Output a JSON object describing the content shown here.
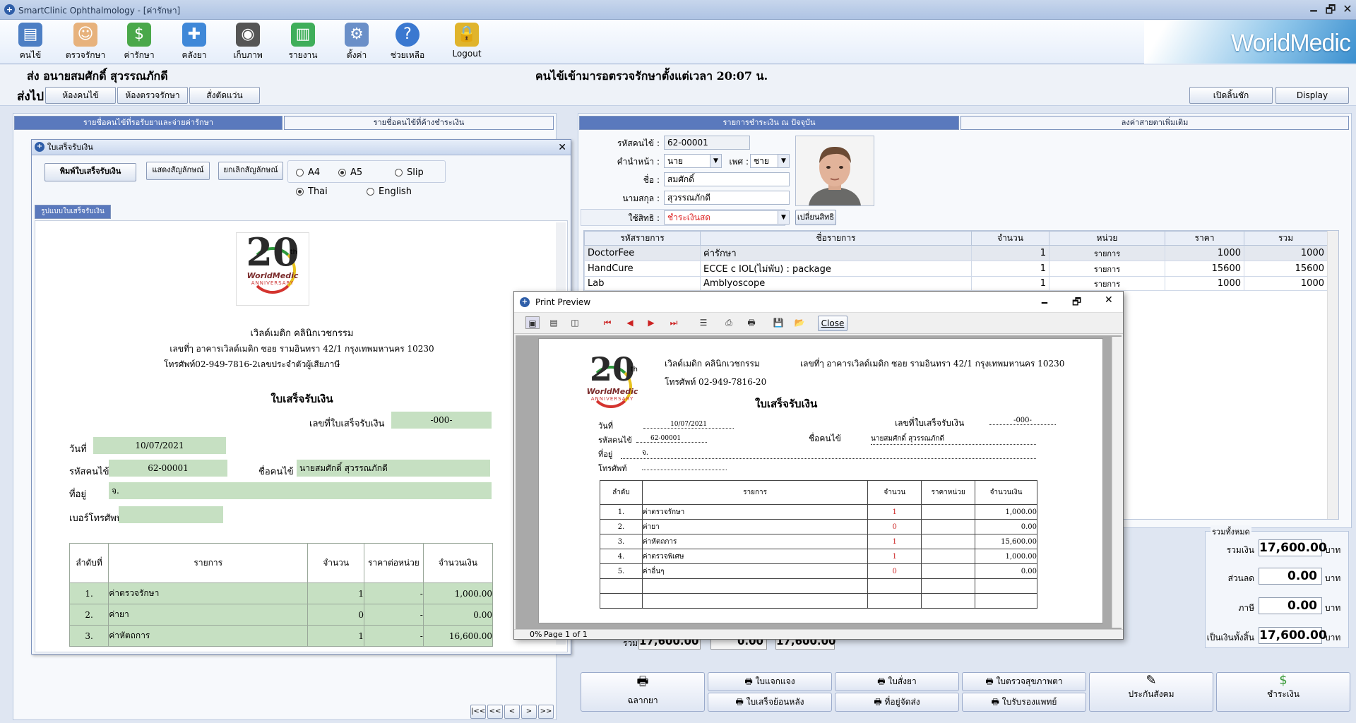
{
  "window": {
    "title": "SmartClinic Ophthalmology - [ค่ารักษา]",
    "minimize": "🗕",
    "restore": "🗗",
    "close": "✕"
  },
  "toolbar": {
    "items": [
      {
        "label": "คนไข้"
      },
      {
        "label": "ตรวจรักษา"
      },
      {
        "label": "ค่ารักษา"
      },
      {
        "label": "คลังยา"
      },
      {
        "label": "เก็บภาพ"
      },
      {
        "label": "รายงาน"
      },
      {
        "label": "ตั้งค่า"
      },
      {
        "label": "ช่วยเหลือ"
      },
      {
        "label": "Logout"
      }
    ],
    "brand": "WorldMedic"
  },
  "banner": {
    "patient": "ส่ง  อนายสมศักดิ์ สุวรรณภักดี",
    "status": "คนไข้เข้ามารอตรวจรักษาตั้งแต่เวลา 20:07 น."
  },
  "nav": {
    "send_to": "ส่งไป",
    "btn1": "ห้องคนไข้",
    "btn2": "ห้องตรวจรักษา",
    "btn3": "สั่งตัดแว่น",
    "open_drawer": "เปิดลิ้นชัก",
    "display": "Display"
  },
  "left_tabs": {
    "tab1": "รายชื่อคนไข้ที่รอรับยาและจ่ายค่ารักษา",
    "tab2": "รายชื่อคนไข้ที่ค้างชำระเงิน"
  },
  "right_tabs": {
    "tab1": "รายการชำระเงิน ณ ปัจจุบัน",
    "tab2": "ลงค่าสายตาเพิ่มเติม"
  },
  "patient": {
    "id_label": "รหัสคนไข้ :",
    "id": "62-00001",
    "prefix_label": "คำนำหน้า :",
    "prefix": "นาย",
    "sex_label": "เพศ :",
    "sex": "ชาย",
    "name_label": "ชื่อ :",
    "name": "สมศักดิ์",
    "surname_label": "นามสกุล :",
    "surname": "สุวรรณภักดี",
    "right_label": "ใช้สิทธิ :",
    "right": "ชำระเงินสด",
    "change_right": "เปลี่ยนสิทธิ",
    "ddarrow": "▼"
  },
  "items_grid": {
    "headers": [
      "รหัสรายการ",
      "ชื่อรายการ",
      "จำนวน",
      "หน่วย",
      "ราคา",
      "รวม"
    ],
    "rows": [
      [
        "DoctorFee",
        "ค่ารักษา",
        "1",
        "รายการ",
        "1000",
        "1000"
      ],
      [
        "HandCure",
        "ECCE c IOL(ไม่พับ) : package",
        "1",
        "รายการ",
        "15600",
        "15600"
      ],
      [
        "Lab",
        "Amblyoscope",
        "1",
        "รายการ",
        "1000",
        "1000"
      ]
    ]
  },
  "totals": {
    "group": "รวมทั้งหมด",
    "sum_label": "รวมเงิน",
    "sum": "17,600.00",
    "discount_label": "ส่วนลด",
    "discount": "0.00",
    "tax_label": "ภาษี",
    "tax": "0.00",
    "net_label": "เป็นเงินทั้งสิ้น",
    "net": "17,600.00",
    "unit": "บาท",
    "under_label": "รวม",
    "under1": "17,600.00",
    "under2": "0.00",
    "under3": "17,600.00"
  },
  "bottom_buttons": {
    "b1": "ฉลากยา",
    "b2": "ใบแจกแจง",
    "b3": "ใบเสร็จย้อนหลัง",
    "b4": "ใบสั่งยา",
    "b5": "ที่อยู่จัดส่ง",
    "b6": "ใบตรวจสุขภาพตา",
    "b7": "ใบรับรองแพทย์",
    "b8": "ประกันสังคม",
    "b9": "ชำระเงิน"
  },
  "receipt_dialog": {
    "title": "ใบเสร็จรับเงิน",
    "print_btn": "พิมพ์ใบเสร็จรับเงิน",
    "show_sign": "แสดงสัญลักษณ์",
    "cancel_sign": "ยกเลิกสัญลักษณ์",
    "size_a4": "A4",
    "size_a5": "A5",
    "size_slip": "Slip",
    "lang_thai": "Thai",
    "lang_en": "English",
    "tab": "รูปแบบใบเสร็จรับเงิน",
    "clinic": "เวิลด์เมดิก คลินิกเวชกรรม",
    "address": "เลขที่ๅ อาคารเวิลด์เมดิก ซอย รามอินทรา 42/1 กรุงเทพมหานคร 10230",
    "phone": "โทรศัพท์02-949-7816-2เลขประจำตัวผู้เสียภาษี",
    "doc_title": "ใบเสร็จรับเงิน",
    "receipt_no_label": "เลขที่ใบเสร็จรับเงิน",
    "receipt_no": "-000-",
    "date_label": "วันที่",
    "date": "10/07/2021",
    "pid_label": "รหัสคนไข้",
    "pid": "62-00001",
    "pname_label": "ชื่อคนไข้",
    "pname": "นายสมศักดิ์ สุวรรณภักดี",
    "addr_label": "ที่อยู่",
    "addr": "จ.",
    "tel_label": "เบอร์โทรศัพท์",
    "tel": "",
    "headers": [
      "ลำดับที่",
      "รายการ",
      "จำนวน",
      "ราคาต่อหน่วย",
      "จำนวนเงิน"
    ],
    "rows": [
      [
        "1.",
        "ค่าตรวจรักษา",
        "1",
        "-",
        "1,000.00"
      ],
      [
        "2.",
        "ค่ายา",
        "0",
        "-",
        "0.00"
      ],
      [
        "3.",
        "ค่าหัตถการ",
        "1",
        "-",
        "16,600.00"
      ]
    ],
    "logo_number": "20",
    "logo_th": "th",
    "logo_name": "WorldMedic",
    "logo_anniv": "ANNIVERSARY"
  },
  "print_preview": {
    "title": "Print Preview",
    "close_btn": "Close",
    "status": "0%",
    "page": "Page 1 of 1",
    "clinic": "เวิลด์เมดิก คลินิกเวชกรรม",
    "address": "เลขที่ๅ อาคารเวิลด์เมดิก ซอย รามอินทรา 42/1 กรุงเทพมหานคร 10230",
    "phone": "โทรศัพท์  02-949-7816-20",
    "doc_title": "ใบเสร็จรับเงิน",
    "date_label": "วันที่",
    "date": "10/07/2021",
    "receipt_no_label": "เลขที่ใบเสร็จรับเงิน",
    "receipt_no": "-000-",
    "pid_label": "รหัสคนไข้",
    "pid": "62-00001",
    "pname_label": "ชื่อคนไข้",
    "pname": "นายสมศักดิ์ สุวรรณภักดี",
    "addr_label": "ที่อยู่",
    "addr": "จ.",
    "tel_label": "โทรศัพท์",
    "headers": [
      "ลำดับ",
      "รายการ",
      "จำนวน",
      "ราคาหน่วย",
      "จำนวนเงิน"
    ],
    "rows": [
      [
        "1.",
        "ค่าตรวจรักษา",
        "1",
        "",
        "1,000.00"
      ],
      [
        "2.",
        "ค่ายา",
        "0",
        "",
        "0.00"
      ],
      [
        "3.",
        "ค่าหัตถการ",
        "1",
        "",
        "15,600.00"
      ],
      [
        "4.",
        "ค่าตรวจพิเศษ",
        "1",
        "",
        "1,000.00"
      ],
      [
        "5.",
        "ค่าอื่นๆ",
        "0",
        "",
        "0.00"
      ]
    ]
  },
  "pager": {
    "first": "|<<",
    "prev_page": "<<",
    "prev": "<",
    "next": ">",
    "next_page": ">>"
  }
}
